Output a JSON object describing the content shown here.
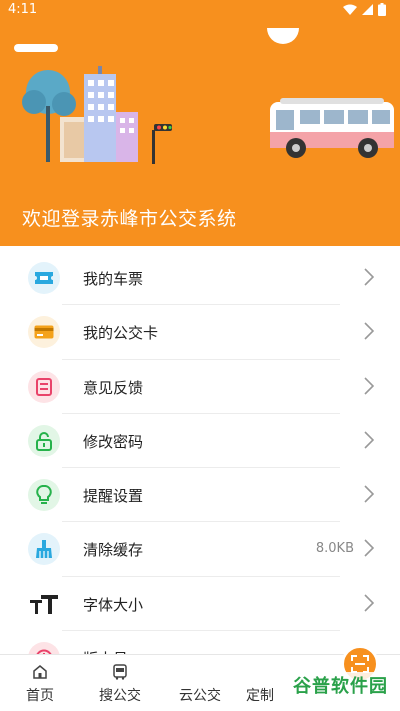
{
  "status_bar": {
    "time": "4:11"
  },
  "header": {
    "welcome": "欢迎登录赤峰市公交系统"
  },
  "menu": [
    {
      "label": "我的车票",
      "value": "",
      "icon": "ticket-icon"
    },
    {
      "label": "我的公交卡",
      "value": "",
      "icon": "card-icon"
    },
    {
      "label": "意见反馈",
      "value": "",
      "icon": "feedback-icon"
    },
    {
      "label": "修改密码",
      "value": "",
      "icon": "lock-icon"
    },
    {
      "label": "提醒设置",
      "value": "",
      "icon": "bulb-icon"
    },
    {
      "label": "清除缓存",
      "value": "8.0KB",
      "icon": "broom-icon"
    },
    {
      "label": "字体大小",
      "value": "",
      "icon": "font-size-icon"
    },
    {
      "label": "版本号",
      "value": "",
      "icon": "info-icon"
    }
  ],
  "tabs": [
    {
      "label": "首页",
      "icon": "home-icon"
    },
    {
      "label": "搜公交",
      "icon": "bus-icon"
    },
    {
      "label": "云公交",
      "icon": "scan-icon"
    },
    {
      "label": "定制",
      "icon": "custom-icon"
    }
  ],
  "watermark": "谷普软件园",
  "colors": {
    "accent": "#f7901e",
    "text": "#222222",
    "muted": "#888888"
  }
}
